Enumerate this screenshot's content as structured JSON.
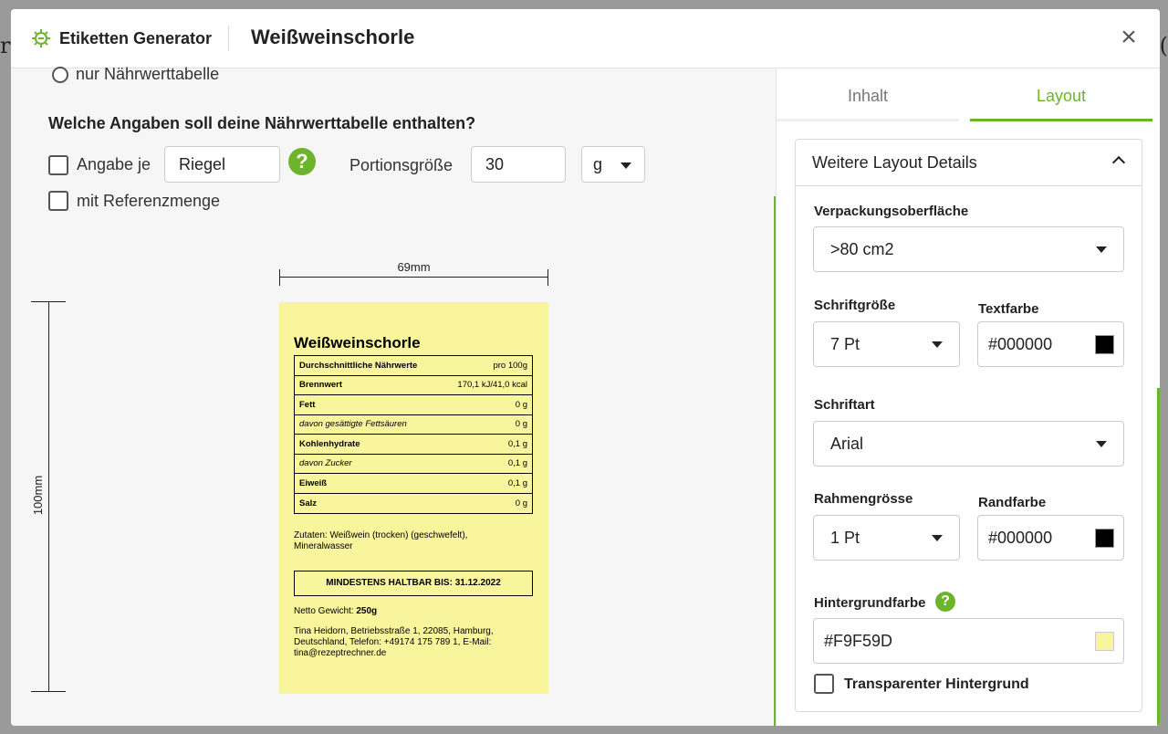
{
  "background": {
    "left_fragment": "r",
    "right_fragment": "("
  },
  "header": {
    "app_name": "Etiketten Generator",
    "doc_title": "Weißweinschorle",
    "close_symbol": "×"
  },
  "left": {
    "radio_label": "nur Nährwerttabelle",
    "question": "Welche Angaben soll deine Nährwerttabelle enthalten?",
    "angabe_label": "Angabe je",
    "angabe_value": "Riegel",
    "help_symbol": "?",
    "portion_label": "Portionsgröße",
    "portion_value": "30",
    "unit_value": "g",
    "ref_label": "mit Referenzmenge",
    "dim_width": "69mm",
    "dim_height": "100mm"
  },
  "label": {
    "background": "#F9F59D",
    "title": "Weißweinschorle",
    "nutrition_header": {
      "name": "Durchschnittliche Nährwerte",
      "value": "pro 100g"
    },
    "nutrition_rows": [
      {
        "name": "Brennwert",
        "value": "170,1 kJ/41,0 kcal"
      },
      {
        "name": "Fett",
        "value": "0 g"
      },
      {
        "name": "davon gesättigte Fettsäuren",
        "value": "0 g"
      },
      {
        "name": "Kohlenhydrate",
        "value": "0,1 g"
      },
      {
        "name": "davon Zucker",
        "value": "0,1 g"
      },
      {
        "name": "Eiweiß",
        "value": "0,1 g"
      },
      {
        "name": "Salz",
        "value": "0 g"
      }
    ],
    "ingredients": "Zutaten: Weißwein (trocken) (geschwefelt), Mineralwasser",
    "mhd": "MINDESTENS HALTBAR BIS: 31.12.2022",
    "netto_label": "Netto Gewicht:",
    "netto_value": "250g",
    "address": "Tina Heidorn, Betriebsstraße 1, 22085, Hamburg, Deutschland, Telefon: +49174 175 789 1, E-Mail: tina@rezeptrechner.de"
  },
  "right": {
    "tabs": [
      {
        "label": "Inhalt"
      },
      {
        "label": "Layout"
      }
    ],
    "card_title": "Weitere Layout Details",
    "verpackung_label": "Verpackungsoberfläche",
    "verpackung_value": ">80 cm2",
    "schriftgroesse_label": "Schriftgröße",
    "schriftgroesse_value": "7 Pt",
    "textfarbe_label": "Textfarbe",
    "textfarbe_value": "#000000",
    "schriftart_label": "Schriftart",
    "schriftart_value": "Arial",
    "rahmen_label": "Rahmengrösse",
    "rahmen_value": "1 Pt",
    "randfarbe_label": "Randfarbe",
    "randfarbe_value": "#000000",
    "hintergrund_label": "Hintergrundfarbe",
    "hintergrund_value": "#F9F59D",
    "transparent_label": "Transparenter Hintergrund"
  },
  "colors": {
    "accent": "#6cb42c",
    "text_swatch": "#000000",
    "border_swatch": "#000000",
    "bg_swatch": "#F9F59D"
  }
}
